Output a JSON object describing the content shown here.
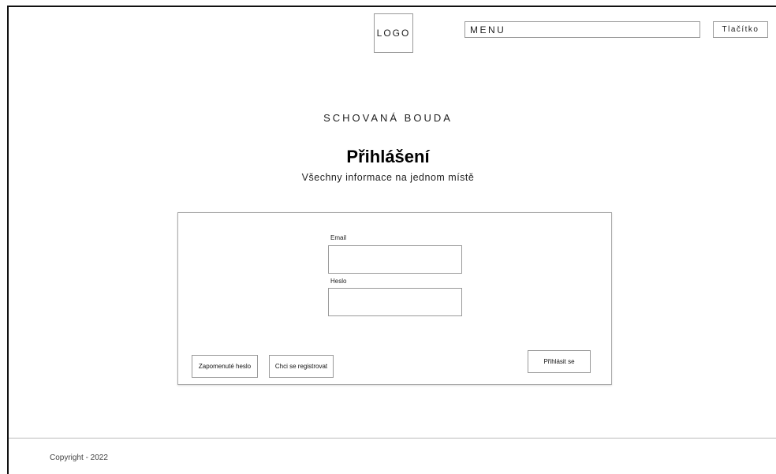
{
  "header": {
    "logo_label": "LOGO",
    "menu_label": "MENU",
    "button_label": "Tlačítko"
  },
  "hero": {
    "site_name": "SCHOVANÁ BOUDA",
    "title": "Přihlášení",
    "subtitle": "Všechny informace na jednom místě"
  },
  "login_form": {
    "email_label": "Email",
    "email_value": "",
    "password_label": "Heslo",
    "password_value": "",
    "forgot_password_label": "Zapomenuté heslo",
    "register_label": "Chci se registrovat",
    "submit_label": "Přihlásit se"
  },
  "footer": {
    "copyright": "Copyright - 2022"
  }
}
